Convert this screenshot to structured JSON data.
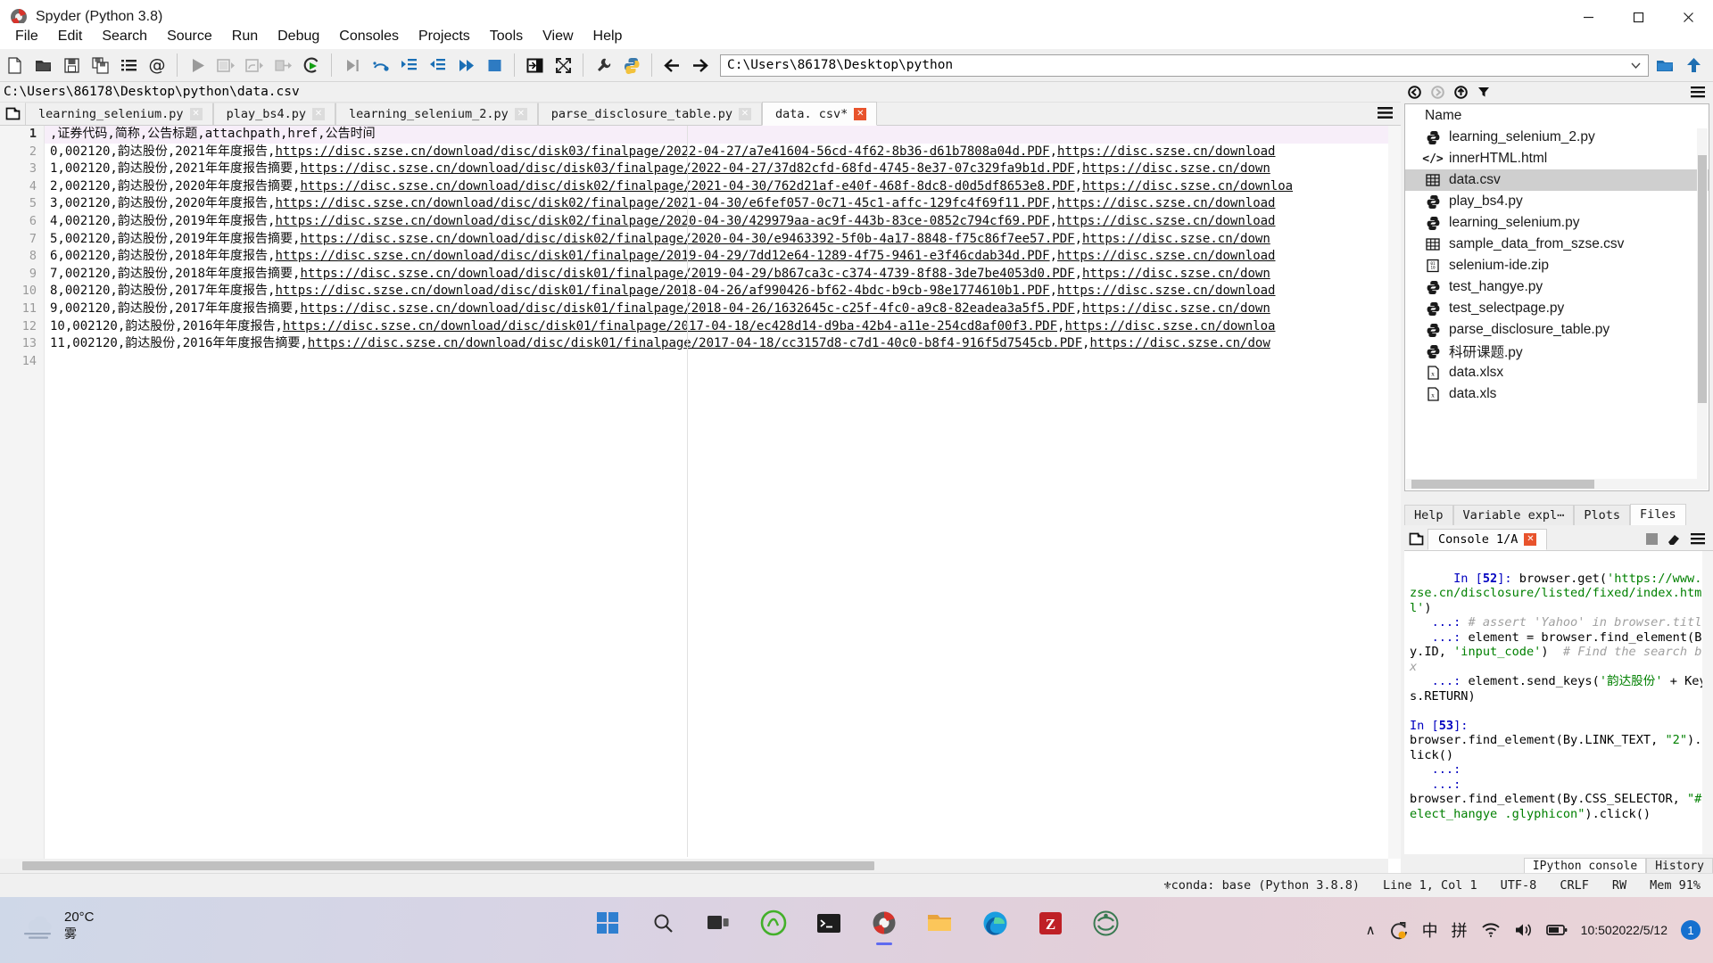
{
  "window": {
    "title": "Spyder (Python 3.8)",
    "controls": {
      "minimize": "─",
      "maximize": "❐",
      "close": "✕"
    }
  },
  "menubar": {
    "items": [
      "File",
      "Edit",
      "Search",
      "Source",
      "Run",
      "Debug",
      "Consoles",
      "Projects",
      "Tools",
      "View",
      "Help"
    ]
  },
  "toolbar": {
    "icons": [
      "new-file-icon",
      "open-file-icon",
      "save-file-icon",
      "save-all-icon",
      "file-switcher-icon",
      "find-symbol-icon",
      "run-file-icon",
      "run-cell-icon",
      "run-cell-advance-icon",
      "run-selection-icon",
      "rerun-file-icon",
      "debug-file-icon",
      "debug-step-over-icon",
      "debug-step-into-icon",
      "debug-step-return-icon",
      "debug-continue-icon",
      "debug-stop-icon",
      "maximize-pane-icon",
      "fullscreen-icon",
      "preferences-icon",
      "pythonpath-manager-icon"
    ],
    "nav_back": "back-arrow-icon",
    "nav_forward": "forward-arrow-icon",
    "path_value": "C:\\Users\\86178\\Desktop\\python",
    "path_dropdown": "chevron-down-icon",
    "browse_dir_icon": "folder-browse-icon",
    "parent_dir_icon": "parent-directory-icon"
  },
  "editor": {
    "file_path": "C:\\Users\\86178\\Desktop\\python\\data.csv",
    "tabs": [
      {
        "label": "learning_selenium.py",
        "active": false,
        "modified": false
      },
      {
        "label": "play_bs4.py",
        "active": false,
        "modified": false
      },
      {
        "label": "learning_selenium_2.py",
        "active": false,
        "modified": false
      },
      {
        "label": "parse_disclosure_table.py",
        "active": false,
        "modified": false
      },
      {
        "label": "data. csv*",
        "active": true,
        "modified": true
      }
    ],
    "tab_options_icon": "hamburger-menu-icon",
    "browse_tabs_icon": "browse-tabs-icon",
    "line_numbers": [
      "1",
      "2",
      "3",
      "4",
      "5",
      "6",
      "7",
      "8",
      "9",
      "10",
      "11",
      "12",
      "13",
      "14"
    ],
    "current_line": 1,
    "lines": [
      ",证券代码,简称,公告标题,attachpath,href,公告时间",
      "0,002120,韵达股份,2021年年度报告,https://disc.szse.cn/download/disc/disk03/finalpage/2022-04-27/a7e41604-56cd-4f62-8b36-d61b7808a04d.PDF,https://disc.szse.cn/download",
      "1,002120,韵达股份,2021年年度报告摘要,https://disc.szse.cn/download/disc/disk03/finalpage/2022-04-27/37d82cfd-68fd-4745-8e37-07c329fa9b1d.PDF,https://disc.szse.cn/down",
      "2,002120,韵达股份,2020年年度报告摘要,https://disc.szse.cn/download/disc/disk02/finalpage/2021-04-30/762d21af-e40f-468f-8dc8-d0d5df8653e8.PDF,https://disc.szse.cn/downloa",
      "3,002120,韵达股份,2020年年度报告,https://disc.szse.cn/download/disc/disk02/finalpage/2021-04-30/e6fef057-0c71-45c1-affc-129fc4f69f11.PDF,https://disc.szse.cn/download",
      "4,002120,韵达股份,2019年年度报告,https://disc.szse.cn/download/disc/disk02/finalpage/2020-04-30/429979aa-ac9f-443b-83ce-0852c794cf69.PDF,https://disc.szse.cn/download",
      "5,002120,韵达股份,2019年年度报告摘要,https://disc.szse.cn/download/disc/disk02/finalpage/2020-04-30/e9463392-5f0b-4a17-8848-f75c86f7ee57.PDF,https://disc.szse.cn/down",
      "6,002120,韵达股份,2018年年度报告,https://disc.szse.cn/download/disc/disk01/finalpage/2019-04-29/7dd12e64-1289-4f75-9461-e3f46cdab34d.PDF,https://disc.szse.cn/download",
      "7,002120,韵达股份,2018年年度报告摘要,https://disc.szse.cn/download/disc/disk01/finalpage/2019-04-29/b867ca3c-c374-4739-8f88-3de7be4053d0.PDF,https://disc.szse.cn/down",
      "8,002120,韵达股份,2017年年度报告,https://disc.szse.cn/download/disc/disk01/finalpage/2018-04-26/af990426-bf62-4bdc-b9cb-98e1774610b1.PDF,https://disc.szse.cn/download",
      "9,002120,韵达股份,2017年年度报告摘要,https://disc.szse.cn/download/disc/disk01/finalpage/2018-04-26/1632645c-c25f-4fc0-a9c8-82eadea3a5f5.PDF,https://disc.szse.cn/down",
      "10,002120,韵达股份,2016年年度报告,https://disc.szse.cn/download/disc/disk01/finalpage/2017-04-18/ec428d14-d9ba-42b4-a11e-254cd8af00f3.PDF,https://disc.szse.cn/downloa",
      "11,002120,韵达股份,2016年年度报告摘要,https://disc.szse.cn/download/disc/disk01/finalpage/2017-04-18/cc3157d8-c7d1-40c0-b8f4-916f5d7545cb.PDF,https://disc.szse.cn/dow",
      ""
    ]
  },
  "files_pane": {
    "toolbar_icons": [
      "back-icon",
      "forward-icon",
      "parent-directory-icon",
      "filter-icon",
      "options-menu-icon"
    ],
    "column_header": "Name",
    "items": [
      {
        "name": "learning_selenium_2.py",
        "icon": "python-file-icon",
        "selected": false
      },
      {
        "name": "innerHTML.html",
        "icon": "html-file-icon",
        "selected": false
      },
      {
        "name": "data.csv",
        "icon": "csv-file-icon",
        "selected": true
      },
      {
        "name": "play_bs4.py",
        "icon": "python-file-icon",
        "selected": false
      },
      {
        "name": "learning_selenium.py",
        "icon": "python-file-icon",
        "selected": false
      },
      {
        "name": "sample_data_from_szse.csv",
        "icon": "csv-file-icon",
        "selected": false
      },
      {
        "name": "selenium-ide.zip",
        "icon": "archive-file-icon",
        "selected": false
      },
      {
        "name": "test_hangye.py",
        "icon": "python-file-icon",
        "selected": false
      },
      {
        "name": "test_selectpage.py",
        "icon": "python-file-icon",
        "selected": false
      },
      {
        "name": "parse_disclosure_table.py",
        "icon": "python-file-icon",
        "selected": false
      },
      {
        "name": "科研课题.py",
        "icon": "python-file-icon",
        "selected": false
      },
      {
        "name": "data.xlsx",
        "icon": "excel-file-icon",
        "selected": false
      },
      {
        "name": "data.xls",
        "icon": "excel-file-icon",
        "selected": false
      }
    ],
    "pane_tabs": [
      {
        "label": "Help",
        "active": false
      },
      {
        "label": "Variable expl⋯",
        "active": false
      },
      {
        "label": "Plots",
        "active": false
      },
      {
        "label": "Files",
        "active": true
      }
    ]
  },
  "console_pane": {
    "browse_icon": "browse-tabs-icon",
    "tab_label": "Console 1/A",
    "tab_close_icon": "close-icon",
    "toolbar_icons": [
      "stop-icon",
      "clear-console-icon",
      "options-menu-icon"
    ],
    "bottom_tabs": [
      {
        "label": "IPython console",
        "active": true
      },
      {
        "label": "History",
        "active": false
      }
    ],
    "blocks": [
      {
        "prompt_prefix": "In [",
        "prompt_number": "52",
        "prompt_suffix": "]: ",
        "segments": [
          {
            "text": "browser.get(",
            "style": "code"
          },
          {
            "text": "'https://www.szse.cn/disclosure/listed/fixed/index.html'",
            "style": "str"
          },
          {
            "text": ")\n",
            "style": "code"
          },
          {
            "text": "   ...: ",
            "style": "in"
          },
          {
            "text": "# assert 'Yahoo' in browser.title",
            "style": "cmt"
          },
          {
            "text": "\n",
            "style": "code"
          },
          {
            "text": "   ...: ",
            "style": "in"
          },
          {
            "text": "element = browser.find_element(By.ID, ",
            "style": "code"
          },
          {
            "text": "'input_code'",
            "style": "str"
          },
          {
            "text": ")  ",
            "style": "code"
          },
          {
            "text": "# Find the search box",
            "style": "cmt"
          },
          {
            "text": "\n",
            "style": "code"
          },
          {
            "text": "   ...: ",
            "style": "in"
          },
          {
            "text": "element.send_keys(",
            "style": "code"
          },
          {
            "text": "'韵达股份'",
            "style": "str"
          },
          {
            "text": " + Keys.RETURN)",
            "style": "code"
          }
        ]
      },
      {
        "prompt_prefix": "In [",
        "prompt_number": "53",
        "prompt_suffix": "]: ",
        "segments": [
          {
            "text": "\nbrowser.find_element(By.LINK_TEXT, ",
            "style": "code"
          },
          {
            "text": "\"2\"",
            "style": "str"
          },
          {
            "text": ").click()\n",
            "style": "code"
          },
          {
            "text": "   ...: ",
            "style": "in"
          },
          {
            "text": "\n",
            "style": "code"
          },
          {
            "text": "   ...: ",
            "style": "in"
          },
          {
            "text": "\nbrowser.find_element(By.CSS_SELECTOR, ",
            "style": "code"
          },
          {
            "text": "\"#select_hangye .glyphicon\"",
            "style": "str"
          },
          {
            "text": ").click()",
            "style": "code"
          }
        ]
      }
    ]
  },
  "statusbar": {
    "conda_icon": "conda-icon",
    "interpreter": "conda: base (Python 3.8.8)",
    "cursor": "Line 1, Col 1",
    "encoding": "UTF-8",
    "eol": "CRLF",
    "permission": "RW",
    "memory": "Mem 91%"
  },
  "taskbar": {
    "weather_temp": "20°C",
    "weather_desc": "雾",
    "weather_icon": "fog-icon",
    "apps": [
      {
        "name": "start-button",
        "icon": "windows-logo-icon",
        "active": false
      },
      {
        "name": "search-button",
        "icon": "search-icon",
        "active": false
      },
      {
        "name": "task-view-button",
        "icon": "task-view-icon",
        "active": false
      },
      {
        "name": "taskbar-app-anaconda",
        "icon": "anaconda-icon",
        "active": false
      },
      {
        "name": "taskbar-app-terminal",
        "icon": "terminal-icon",
        "active": false
      },
      {
        "name": "taskbar-app-spyder",
        "icon": "spyder-icon",
        "active": true
      },
      {
        "name": "taskbar-app-explorer",
        "icon": "file-explorer-icon",
        "active": false
      },
      {
        "name": "taskbar-app-edge",
        "icon": "edge-icon",
        "active": false
      },
      {
        "name": "taskbar-app-filezilla",
        "icon": "filezilla-icon",
        "active": false
      },
      {
        "name": "taskbar-app-jupyter",
        "icon": "jupyter-icon",
        "active": false
      }
    ],
    "tray": {
      "chevron": "∧",
      "onedrive_icon": "onedrive-sync-icon",
      "ime_mode": "中",
      "ime_pinyin": "拼",
      "wifi_icon": "wifi-icon",
      "volume_icon": "volume-icon",
      "battery_icon": "battery-icon",
      "time": "10:50",
      "date": "2022/5/12",
      "notification_count": "1"
    }
  }
}
